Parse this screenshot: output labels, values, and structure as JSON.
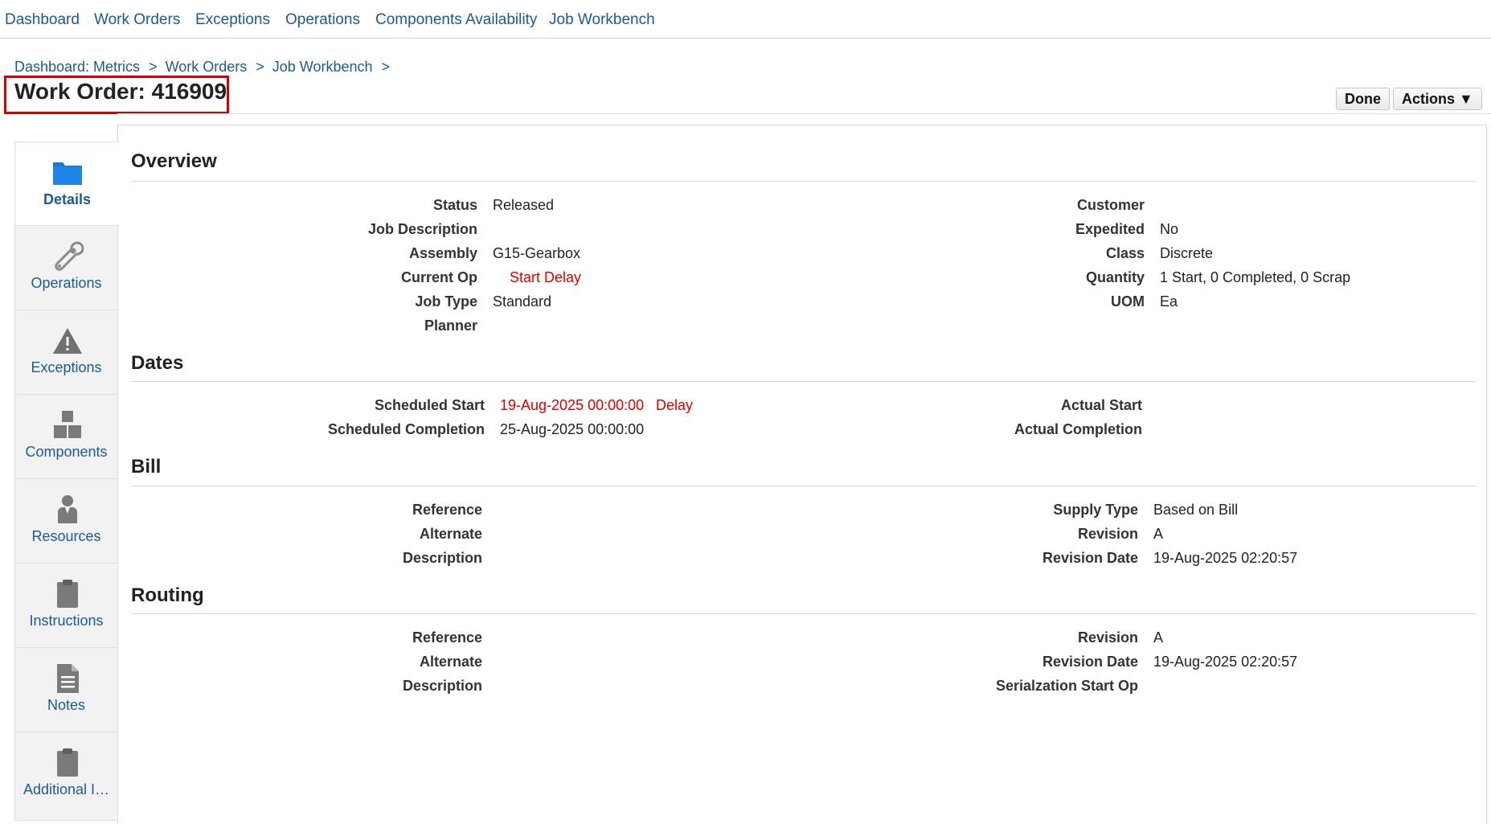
{
  "topnav": [
    "Dashboard",
    "Work Orders",
    "Exceptions",
    "Operations",
    "Components Availability",
    "Job Workbench"
  ],
  "breadcrumb": [
    "Dashboard: Metrics",
    "Work Orders",
    "Job Workbench"
  ],
  "breadcrumb_sep": ">",
  "title": "Work Order: 416909",
  "buttons": {
    "done": "Done",
    "actions": "Actions ▼"
  },
  "tabs": [
    {
      "label": "Details",
      "icon": "folder-icon",
      "active": true
    },
    {
      "label": "Operations",
      "icon": "gear-wrench-icon"
    },
    {
      "label": "Exceptions",
      "icon": "warning-icon"
    },
    {
      "label": "Components",
      "icon": "boxes-icon"
    },
    {
      "label": "Resources",
      "icon": "person-icon"
    },
    {
      "label": "Instructions",
      "icon": "clipboard-icon"
    },
    {
      "label": "Notes",
      "icon": "document-icon"
    },
    {
      "label": "Additional I…",
      "icon": "clipboard-icon"
    }
  ],
  "overview": {
    "title": "Overview",
    "left": [
      {
        "label": "Status",
        "value": "Released"
      },
      {
        "label": "Job Description",
        "value": ""
      },
      {
        "label": "Assembly",
        "value": "G15-Gearbox"
      },
      {
        "label": "Current Op",
        "value": "Start Delay"
      },
      {
        "label": "Job Type",
        "value": "Standard"
      },
      {
        "label": "Planner",
        "value": ""
      }
    ],
    "right": [
      {
        "label": "Customer",
        "value": ""
      },
      {
        "label": "Expedited",
        "value": "No"
      },
      {
        "label": "Class",
        "value": "Discrete"
      },
      {
        "label": "Quantity",
        "value": "1 Start, 0 Completed, 0 Scrap"
      },
      {
        "label": "UOM",
        "value": "Ea"
      }
    ]
  },
  "dates": {
    "title": "Dates",
    "left": [
      {
        "label": "Scheduled Start",
        "value": "19-Aug-2025 00:00:00",
        "flag": "Delay"
      },
      {
        "label": "Scheduled Completion",
        "value": "25-Aug-2025 00:00:00"
      }
    ],
    "right": [
      {
        "label": "Actual Start",
        "value": ""
      },
      {
        "label": "Actual Completion",
        "value": ""
      }
    ]
  },
  "bill": {
    "title": "Bill",
    "left": [
      {
        "label": "Reference",
        "value": ""
      },
      {
        "label": "Alternate",
        "value": ""
      },
      {
        "label": "Description",
        "value": ""
      }
    ],
    "right": [
      {
        "label": "Supply Type",
        "value": "Based on Bill"
      },
      {
        "label": "Revision",
        "value": "A"
      },
      {
        "label": "Revision Date",
        "value": "19-Aug-2025 02:20:57"
      }
    ]
  },
  "routing": {
    "title": "Routing",
    "left": [
      {
        "label": "Reference",
        "value": ""
      },
      {
        "label": "Alternate",
        "value": ""
      },
      {
        "label": "Description",
        "value": ""
      }
    ],
    "right": [
      {
        "label": "Revision",
        "value": "A"
      },
      {
        "label": "Revision Date",
        "value": "19-Aug-2025 02:20:57"
      },
      {
        "label": "Serialzation Start Op",
        "value": ""
      }
    ]
  },
  "colors": {
    "link": "#1a5a96",
    "alert": "#e00000",
    "highlight_box": "#d80000"
  }
}
